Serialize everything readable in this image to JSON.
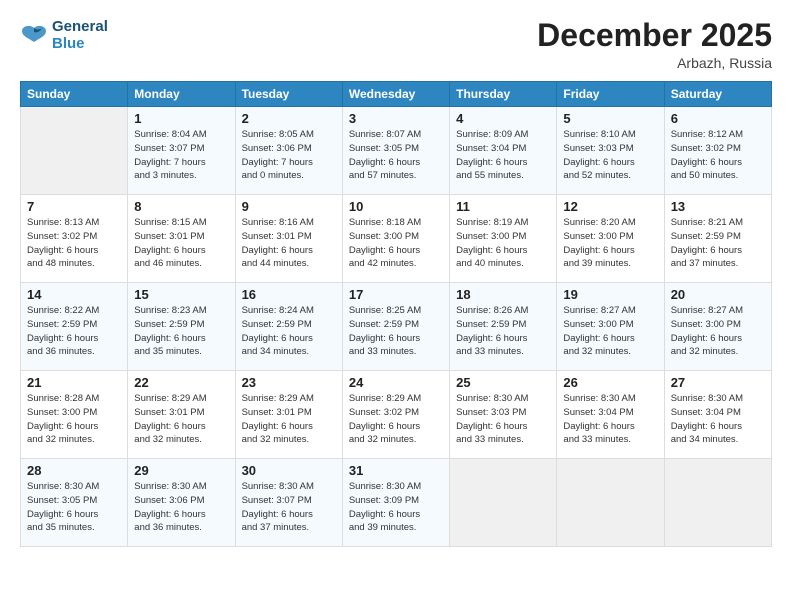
{
  "header": {
    "logo_line1": "General",
    "logo_line2": "Blue",
    "month": "December 2025",
    "location": "Arbazh, Russia"
  },
  "weekdays": [
    "Sunday",
    "Monday",
    "Tuesday",
    "Wednesday",
    "Thursday",
    "Friday",
    "Saturday"
  ],
  "weeks": [
    [
      {
        "day": null,
        "info": null
      },
      {
        "day": "1",
        "info": "Sunrise: 8:04 AM\nSunset: 3:07 PM\nDaylight: 7 hours\nand 3 minutes."
      },
      {
        "day": "2",
        "info": "Sunrise: 8:05 AM\nSunset: 3:06 PM\nDaylight: 7 hours\nand 0 minutes."
      },
      {
        "day": "3",
        "info": "Sunrise: 8:07 AM\nSunset: 3:05 PM\nDaylight: 6 hours\nand 57 minutes."
      },
      {
        "day": "4",
        "info": "Sunrise: 8:09 AM\nSunset: 3:04 PM\nDaylight: 6 hours\nand 55 minutes."
      },
      {
        "day": "5",
        "info": "Sunrise: 8:10 AM\nSunset: 3:03 PM\nDaylight: 6 hours\nand 52 minutes."
      },
      {
        "day": "6",
        "info": "Sunrise: 8:12 AM\nSunset: 3:02 PM\nDaylight: 6 hours\nand 50 minutes."
      }
    ],
    [
      {
        "day": "7",
        "info": "Sunrise: 8:13 AM\nSunset: 3:02 PM\nDaylight: 6 hours\nand 48 minutes."
      },
      {
        "day": "8",
        "info": "Sunrise: 8:15 AM\nSunset: 3:01 PM\nDaylight: 6 hours\nand 46 minutes."
      },
      {
        "day": "9",
        "info": "Sunrise: 8:16 AM\nSunset: 3:01 PM\nDaylight: 6 hours\nand 44 minutes."
      },
      {
        "day": "10",
        "info": "Sunrise: 8:18 AM\nSunset: 3:00 PM\nDaylight: 6 hours\nand 42 minutes."
      },
      {
        "day": "11",
        "info": "Sunrise: 8:19 AM\nSunset: 3:00 PM\nDaylight: 6 hours\nand 40 minutes."
      },
      {
        "day": "12",
        "info": "Sunrise: 8:20 AM\nSunset: 3:00 PM\nDaylight: 6 hours\nand 39 minutes."
      },
      {
        "day": "13",
        "info": "Sunrise: 8:21 AM\nSunset: 2:59 PM\nDaylight: 6 hours\nand 37 minutes."
      }
    ],
    [
      {
        "day": "14",
        "info": "Sunrise: 8:22 AM\nSunset: 2:59 PM\nDaylight: 6 hours\nand 36 minutes."
      },
      {
        "day": "15",
        "info": "Sunrise: 8:23 AM\nSunset: 2:59 PM\nDaylight: 6 hours\nand 35 minutes."
      },
      {
        "day": "16",
        "info": "Sunrise: 8:24 AM\nSunset: 2:59 PM\nDaylight: 6 hours\nand 34 minutes."
      },
      {
        "day": "17",
        "info": "Sunrise: 8:25 AM\nSunset: 2:59 PM\nDaylight: 6 hours\nand 33 minutes."
      },
      {
        "day": "18",
        "info": "Sunrise: 8:26 AM\nSunset: 2:59 PM\nDaylight: 6 hours\nand 33 minutes."
      },
      {
        "day": "19",
        "info": "Sunrise: 8:27 AM\nSunset: 3:00 PM\nDaylight: 6 hours\nand 32 minutes."
      },
      {
        "day": "20",
        "info": "Sunrise: 8:27 AM\nSunset: 3:00 PM\nDaylight: 6 hours\nand 32 minutes."
      }
    ],
    [
      {
        "day": "21",
        "info": "Sunrise: 8:28 AM\nSunset: 3:00 PM\nDaylight: 6 hours\nand 32 minutes."
      },
      {
        "day": "22",
        "info": "Sunrise: 8:29 AM\nSunset: 3:01 PM\nDaylight: 6 hours\nand 32 minutes."
      },
      {
        "day": "23",
        "info": "Sunrise: 8:29 AM\nSunset: 3:01 PM\nDaylight: 6 hours\nand 32 minutes."
      },
      {
        "day": "24",
        "info": "Sunrise: 8:29 AM\nSunset: 3:02 PM\nDaylight: 6 hours\nand 32 minutes."
      },
      {
        "day": "25",
        "info": "Sunrise: 8:30 AM\nSunset: 3:03 PM\nDaylight: 6 hours\nand 33 minutes."
      },
      {
        "day": "26",
        "info": "Sunrise: 8:30 AM\nSunset: 3:04 PM\nDaylight: 6 hours\nand 33 minutes."
      },
      {
        "day": "27",
        "info": "Sunrise: 8:30 AM\nSunset: 3:04 PM\nDaylight: 6 hours\nand 34 minutes."
      }
    ],
    [
      {
        "day": "28",
        "info": "Sunrise: 8:30 AM\nSunset: 3:05 PM\nDaylight: 6 hours\nand 35 minutes."
      },
      {
        "day": "29",
        "info": "Sunrise: 8:30 AM\nSunset: 3:06 PM\nDaylight: 6 hours\nand 36 minutes."
      },
      {
        "day": "30",
        "info": "Sunrise: 8:30 AM\nSunset: 3:07 PM\nDaylight: 6 hours\nand 37 minutes."
      },
      {
        "day": "31",
        "info": "Sunrise: 8:30 AM\nSunset: 3:09 PM\nDaylight: 6 hours\nand 39 minutes."
      },
      {
        "day": null,
        "info": null
      },
      {
        "day": null,
        "info": null
      },
      {
        "day": null,
        "info": null
      }
    ]
  ]
}
